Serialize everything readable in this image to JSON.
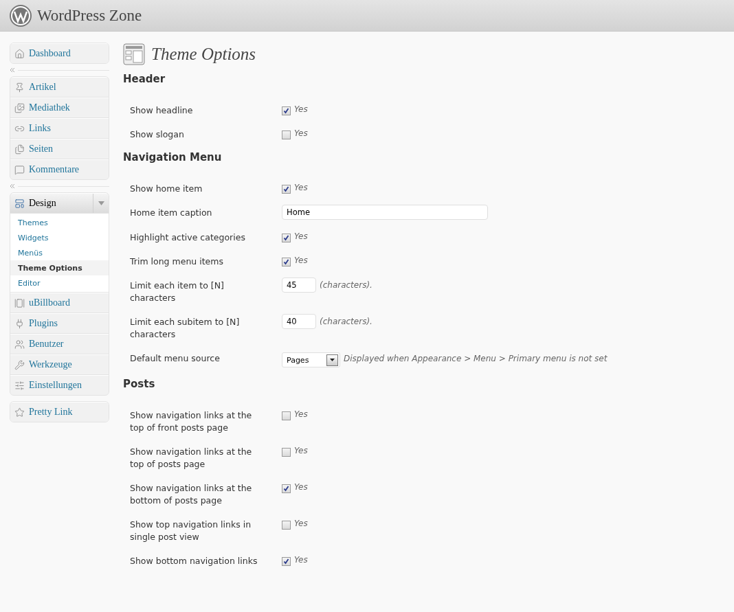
{
  "site_title": "WordPress Zone",
  "sidebar": {
    "groups": [
      {
        "items": [
          {
            "label": "Dashboard",
            "expanded": false
          }
        ]
      },
      {
        "items": [
          {
            "label": "Artikel",
            "expanded": false
          },
          {
            "label": "Mediathek",
            "expanded": false
          },
          {
            "label": "Links",
            "expanded": false
          },
          {
            "label": "Seiten",
            "expanded": false
          },
          {
            "label": "Kommentare",
            "expanded": false
          }
        ]
      },
      {
        "items": [
          {
            "label": "Design",
            "expanded": true,
            "children": [
              {
                "label": "Themes",
                "selected": false
              },
              {
                "label": "Widgets",
                "selected": false
              },
              {
                "label": "Menüs",
                "selected": false
              },
              {
                "label": "Theme Options",
                "selected": true
              },
              {
                "label": "Editor",
                "selected": false
              }
            ]
          },
          {
            "label": "uBillboard",
            "expanded": false
          },
          {
            "label": "Plugins",
            "expanded": false
          },
          {
            "label": "Benutzer",
            "expanded": false
          },
          {
            "label": "Werkzeuge",
            "expanded": false
          },
          {
            "label": "Einstellungen",
            "expanded": false
          }
        ]
      },
      {
        "items": [
          {
            "label": "Pretty Link",
            "expanded": false
          }
        ]
      }
    ]
  },
  "page_title": "Theme Options",
  "sections": [
    {
      "heading": "Header",
      "rows": [
        {
          "kind": "checkbox",
          "label": "Show headline",
          "checked": true,
          "option": "Yes"
        },
        {
          "kind": "checkbox",
          "label": "Show slogan",
          "checked": false,
          "option": "Yes"
        }
      ]
    },
    {
      "heading": "Navigation Menu",
      "rows": [
        {
          "kind": "checkbox",
          "label": "Show home item",
          "checked": true,
          "option": "Yes"
        },
        {
          "kind": "text",
          "label": "Home item caption",
          "value": "Home"
        },
        {
          "kind": "checkbox",
          "label": "Highlight active categories",
          "checked": true,
          "option": "Yes"
        },
        {
          "kind": "checkbox",
          "label": "Trim long menu items",
          "checked": true,
          "option": "Yes"
        },
        {
          "kind": "number",
          "label": "Limit each item to [N] characters",
          "value": "45",
          "note": "(characters)."
        },
        {
          "kind": "number",
          "label": "Limit each subitem to [N] characters",
          "value": "40",
          "note": "(characters)."
        },
        {
          "kind": "select",
          "label": "Default menu source",
          "value": "Pages",
          "note": "Displayed when Appearance > Menu > Primary menu is not set"
        }
      ]
    },
    {
      "heading": "Posts",
      "rows": [
        {
          "kind": "checkbox",
          "label": "Show navigation links at the top of front posts page",
          "checked": false,
          "option": "Yes"
        },
        {
          "kind": "checkbox",
          "label": "Show navigation links at the top of posts page",
          "checked": false,
          "option": "Yes"
        },
        {
          "kind": "checkbox",
          "label": "Show navigation links at the bottom of posts page",
          "checked": true,
          "option": "Yes"
        },
        {
          "kind": "checkbox",
          "label": "Show top navigation links in single post view",
          "checked": false,
          "option": "Yes"
        },
        {
          "kind": "checkbox",
          "label": "Show bottom navigation links",
          "checked": true,
          "option": "Yes"
        }
      ]
    }
  ]
}
